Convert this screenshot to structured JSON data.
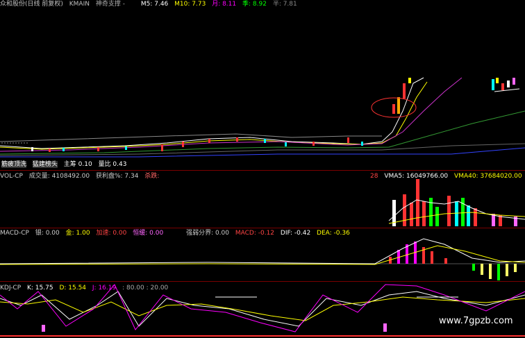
{
  "main": {
    "title": "众和股份(日线 前复权)",
    "indicator": "KMAIN",
    "support": "神奇支撑 -",
    "m5": "M5: 7.46",
    "m10": "M10: 7.73",
    "month": "月: 8.11",
    "season": "季: 8.92",
    "half": "半: 7.81",
    "colors": {
      "m5": "#ffffff",
      "m10": "#ffff00",
      "month": "#ff00ff",
      "season": "#00ff00",
      "half": "#888888"
    }
  },
  "overlay": {
    "item1": "筋疲顶洗",
    "item2": "猛建榜头",
    "item3": "主筹 0.10",
    "item4": "量比 0.43"
  },
  "vol": {
    "name": "VOL-CP",
    "volume": "成交量: 4108492.00",
    "profit": "获利盘%: 7.34",
    "note": "杀跌:",
    "marker": "28",
    "vma5": "VMA5: 16049766.00",
    "vma40": "VMA40: 37684020.00"
  },
  "macd": {
    "name": "MACD-CP",
    "silver": "银: 0.00",
    "gold": "金: 1.00",
    "speed_up": "加速: 0.00",
    "slow": "恒缓: 0.00",
    "divide": "强弱分界: 0.00",
    "macd": "MACD: -0.12",
    "dif": "DIF: -0.42",
    "dea": "DEA: -0.36"
  },
  "kdj": {
    "name": "KDJ-CP",
    "k": "K: 15.75",
    "d": "D: 15.54",
    "j": "J: 16.19",
    "levels": ": 80.00 : 20.00"
  },
  "watermark": "www.7gpzb.com"
}
